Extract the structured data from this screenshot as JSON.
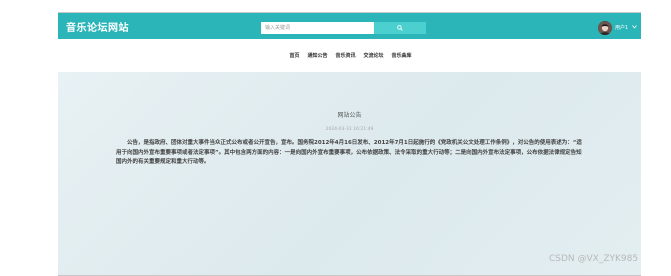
{
  "header": {
    "site_title": "音乐论坛网站",
    "search_placeholder": "输入关键词",
    "user_label": "用户1",
    "avatar_icon": "user-avatar",
    "search_icon": "search-icon",
    "dropdown_icon": "chevron-down-icon",
    "bg_color": "#2bb5b8",
    "search_button_color": "#4cd0cf"
  },
  "nav": {
    "items": [
      "首页",
      "通知公告",
      "音乐资讯",
      "交流论坛",
      "音乐曲库"
    ]
  },
  "notice": {
    "title": "网站公告",
    "date": "2024-03-31 16:21:49",
    "body": "公告，是指政府、团体对重大事件当众正式公布或者公开宣告，宣布。国务院2012年4月16日发布、2012年7月1日起施行的《党政机关公文处理工作条例》，对公告的使用表述为：“适用于向国内外宣布重要事项或者法定事项”。其中包含两方面的内容：一是向国内外宣布重要事项，公布依据政策、法令采取的重大行动等；二是向国内外宣布法定事项，公布依据法律规定告知国内外的有关重要规定和重大行动等。"
  },
  "watermark": "CSDN @VX_ZYK985"
}
